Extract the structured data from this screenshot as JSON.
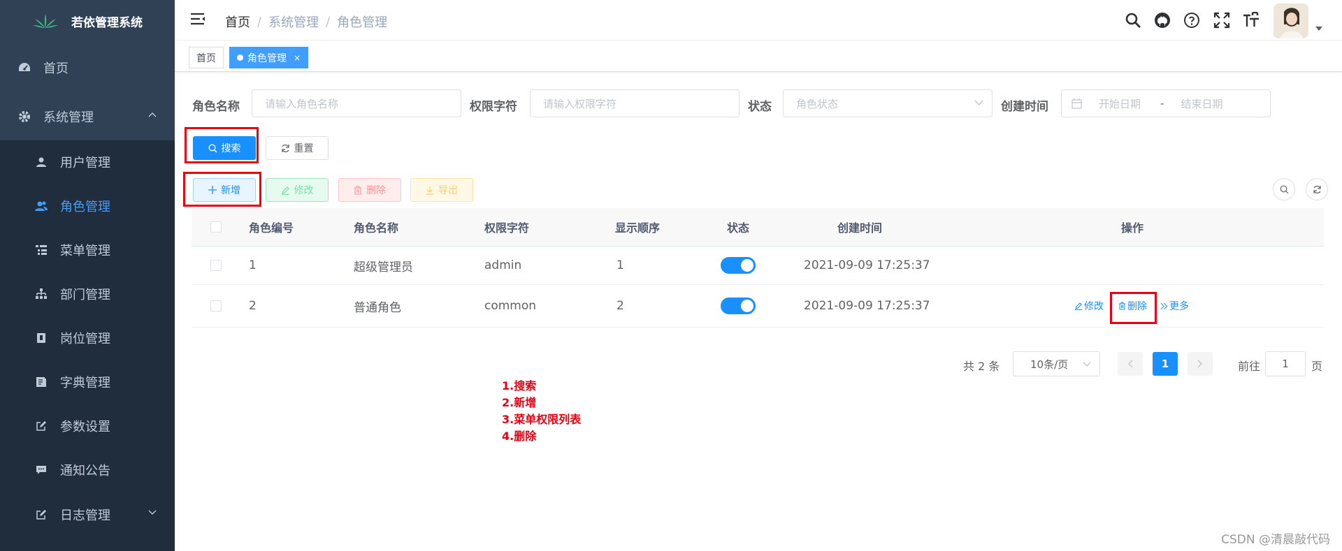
{
  "app": {
    "title": "若依管理系统"
  },
  "sidebar": {
    "home": "首页",
    "system": "系统管理",
    "items": [
      {
        "label": "用户管理",
        "icon": "user-icon"
      },
      {
        "label": "角色管理",
        "icon": "peoples-icon"
      },
      {
        "label": "菜单管理",
        "icon": "tree-table-icon"
      },
      {
        "label": "部门管理",
        "icon": "tree-icon"
      },
      {
        "label": "岗位管理",
        "icon": "post-icon"
      },
      {
        "label": "字典管理",
        "icon": "dict-icon"
      },
      {
        "label": "参数设置",
        "icon": "edit-icon"
      },
      {
        "label": "通知公告",
        "icon": "message-icon"
      }
    ],
    "log": "日志管理"
  },
  "breadcrumb": [
    "首页",
    "系统管理",
    "角色管理"
  ],
  "tags": {
    "home": "首页",
    "active": "角色管理",
    "close": "×"
  },
  "search": {
    "role_name_label": "角色名称",
    "role_name_placeholder": "请输入角色名称",
    "role_key_label": "权限字符",
    "role_key_placeholder": "请输入权限字符",
    "status_label": "状态",
    "status_placeholder": "角色状态",
    "created_label": "创建时间",
    "start_placeholder": "开始日期",
    "range_sep": "-",
    "end_placeholder": "结束日期",
    "search_btn": "搜索",
    "reset_btn": "重置"
  },
  "toolbar": {
    "add": "新增",
    "edit": "修改",
    "delete": "删除",
    "export": "导出"
  },
  "table": {
    "headers": [
      "角色编号",
      "角色名称",
      "权限字符",
      "显示顺序",
      "状态",
      "创建时间",
      "操作"
    ],
    "rows": [
      {
        "id": "1",
        "name": "超级管理员",
        "key": "admin",
        "sort": "1",
        "status": true,
        "created": "2021-09-09 17:25:37"
      },
      {
        "id": "2",
        "name": "普通角色",
        "key": "common",
        "sort": "2",
        "status": true,
        "created": "2021-09-09 17:25:37"
      }
    ],
    "ops": {
      "edit": "修改",
      "delete": "删除",
      "more": "更多"
    }
  },
  "pagination": {
    "total": "共 2 条",
    "page_size": "10条/页",
    "current": "1",
    "goto": "前往",
    "goto_value": "1",
    "page_unit": "页"
  },
  "notes": [
    "1.搜索",
    "2.新增",
    "3.菜单权限列表",
    "4.删除"
  ],
  "watermark": "CSDN @清晨敲代码",
  "colors": {
    "sidebar_bg": "#304156",
    "primary": "#1890ff",
    "annotation_red": "#e60012"
  }
}
